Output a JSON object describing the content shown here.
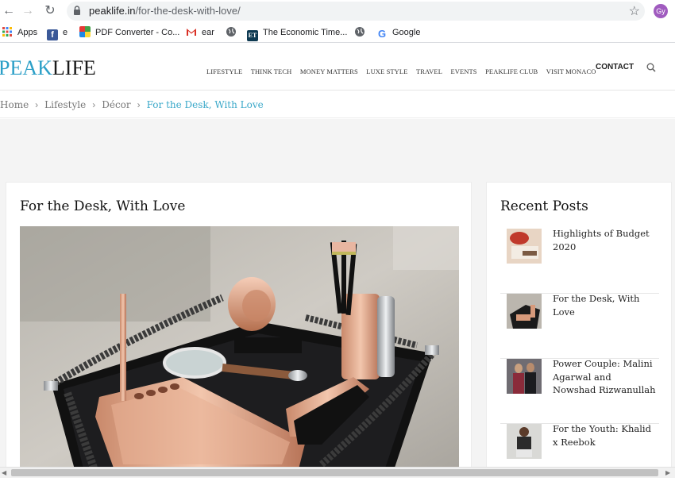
{
  "browser": {
    "url_domain": "peaklife.in",
    "url_path": "/for-the-desk-with-love/",
    "profile_initials": "Gy",
    "bookmarks": [
      {
        "label": "Apps",
        "icon": "apps-grid-icon"
      },
      {
        "label": "e",
        "icon": "facebook-icon"
      },
      {
        "label": "PDF Converter - Co...",
        "icon": "pdf-converter-icon"
      },
      {
        "label": "ear",
        "icon": "gmail-icon"
      },
      {
        "label": "",
        "icon": "globe-icon"
      },
      {
        "label": "The Economic Time...",
        "icon": "economic-times-icon"
      },
      {
        "label": "",
        "icon": "globe-icon"
      },
      {
        "label": "Google",
        "icon": "google-icon"
      }
    ]
  },
  "site": {
    "logo_part1": "PEAK",
    "logo_part2": "LIFE",
    "nav": [
      "LIFESTYLE",
      "THINK TECH",
      "MONEY MATTERS",
      "LUXE STYLE",
      "TRAVEL",
      "EVENTS",
      "PEAKLIFE CLUB",
      "VISIT MONACO"
    ],
    "contact": "CONTACT",
    "accent_color": "#3aa8c9"
  },
  "breadcrumb": [
    "Home",
    "Lifestyle",
    "Décor",
    "For the Desk, With Love"
  ],
  "article": {
    "title": "For the Desk, With Love"
  },
  "sidebar": {
    "title": "Recent Posts",
    "posts": [
      {
        "title": "Highlights of Budget 2020"
      },
      {
        "title": "For the Desk, With Love"
      },
      {
        "title": "Power Couple: Malini Agarwal and Nowshad Rizwanullah"
      },
      {
        "title": "For the Youth: Khalid x Reebok"
      }
    ]
  }
}
